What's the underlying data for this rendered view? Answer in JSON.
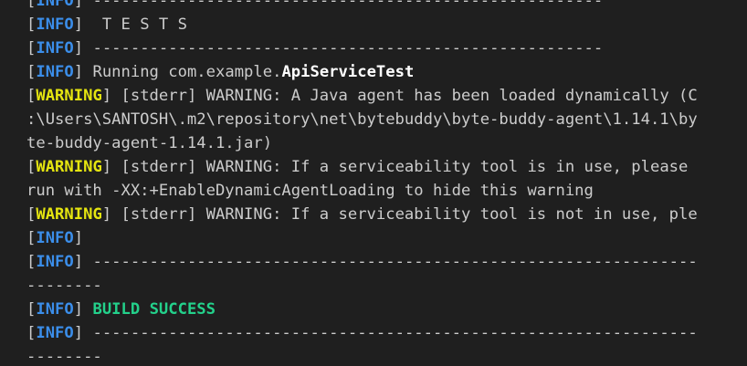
{
  "terminal": {
    "colors": {
      "background": "#1f1f1f",
      "text": "#cccccc",
      "info": "#3b8eea",
      "warning": "#e5e510",
      "success": "#23d18b"
    },
    "lines": [
      {
        "kind": "info",
        "tag": "INFO",
        "text": " ------------------------------------------------------"
      },
      {
        "kind": "info",
        "tag": "INFO",
        "text": "  T E S T S"
      },
      {
        "kind": "info",
        "tag": "INFO",
        "text": " ------------------------------------------------------"
      },
      {
        "kind": "info-run",
        "tag": "INFO",
        "prefix": " Running com.example.",
        "cls": "ApiServiceTest"
      },
      {
        "kind": "warning",
        "tag": "WARNING",
        "text": " [stderr] WARNING: A Java agent has been loaded dynamically (C"
      },
      {
        "kind": "plain",
        "text": ":\\Users\\SANTOSH\\.m2\\repository\\net\\bytebuddy\\byte-buddy-agent\\1.14.1\\by"
      },
      {
        "kind": "plain",
        "text": "te-buddy-agent-1.14.1.jar)"
      },
      {
        "kind": "warning",
        "tag": "WARNING",
        "text": " [stderr] WARNING: If a serviceability tool is in use, please"
      },
      {
        "kind": "plain",
        "text": "run with -XX:+EnableDynamicAgentLoading to hide this warning"
      },
      {
        "kind": "warning",
        "tag": "WARNING",
        "text": " [stderr] WARNING: If a serviceability tool is not in use, ple"
      },
      {
        "kind": "info",
        "tag": "INFO",
        "text": ""
      },
      {
        "kind": "info",
        "tag": "INFO",
        "text": " ----------------------------------------------------------------"
      },
      {
        "kind": "plain",
        "text": "--------"
      },
      {
        "kind": "info-success",
        "tag": "INFO",
        "prefix": " ",
        "success": "BUILD SUCCESS"
      },
      {
        "kind": "info",
        "tag": "INFO",
        "text": " ----------------------------------------------------------------"
      },
      {
        "kind": "plain",
        "text": "--------"
      }
    ]
  }
}
